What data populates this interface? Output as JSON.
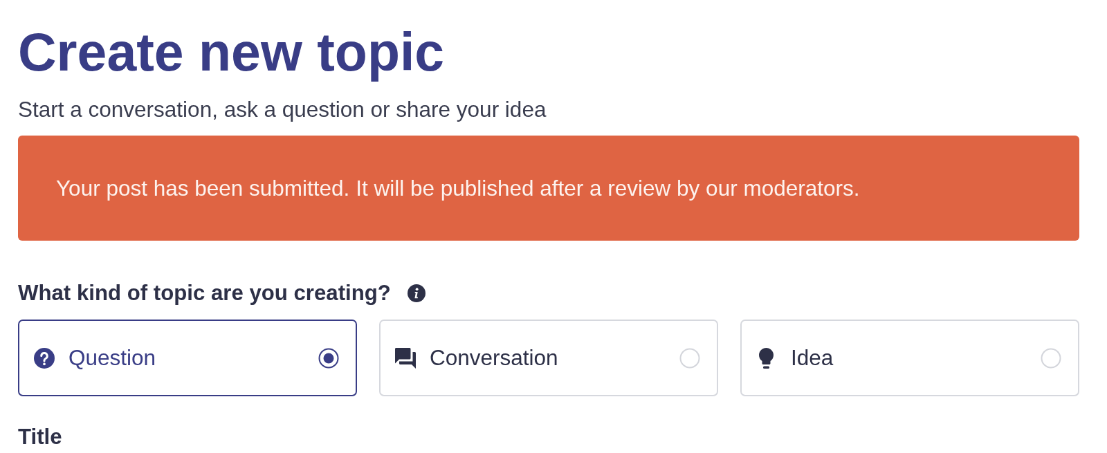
{
  "page": {
    "title": "Create new topic",
    "subtitle": "Start a conversation, ask a question or share your idea"
  },
  "notice": {
    "text": "Your post has been submitted. It will be published after a review by our moderators."
  },
  "topic_type": {
    "label": "What kind of topic are you creating?",
    "options": [
      {
        "label": "Question",
        "kind": "question",
        "selected": true
      },
      {
        "label": "Conversation",
        "kind": "conversation",
        "selected": false
      },
      {
        "label": "Idea",
        "kind": "idea",
        "selected": false
      }
    ]
  },
  "title_field": {
    "label": "Title"
  }
}
